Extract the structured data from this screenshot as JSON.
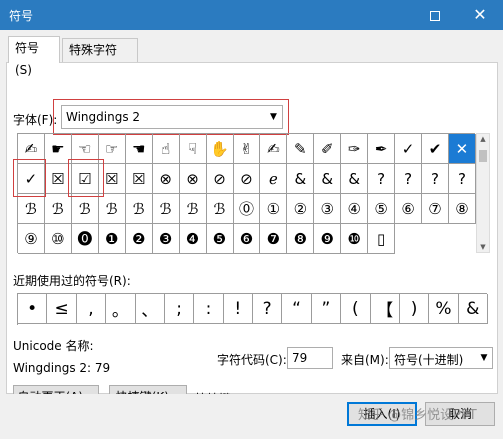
{
  "window": {
    "title": "符号"
  },
  "tabs": [
    {
      "label": "符号(S)"
    },
    {
      "label": "特殊字符(P)"
    }
  ],
  "font": {
    "label": "字体(F):",
    "value": "Wingdings 2",
    "dropdown_icon": "chevron-down-icon"
  },
  "symbols": [
    "✍",
    "☛",
    "☜",
    "☞",
    "☚",
    "☝",
    "☟",
    "✋",
    "✌",
    "✍",
    "✎",
    "✐",
    "✑",
    "✒",
    "✓",
    "✔",
    "✕",
    "✓",
    "☒",
    "☑",
    "☒",
    "☒",
    "⊗",
    "⊗",
    "⊘",
    "⊘",
    "ℯ",
    "&",
    "&",
    "&",
    "?",
    "?",
    "?",
    "?",
    "ℬ",
    "ℬ",
    "ℬ",
    "ℬ",
    "ℬ",
    "ℬ",
    "ℬ",
    "ℬ",
    "⓪",
    "①",
    "②",
    "③",
    "④",
    "⑤",
    "⑥",
    "⑦",
    "⑧",
    "⑨",
    "⑩",
    "⓿",
    "❶",
    "❷",
    "❸",
    "❹",
    "❺",
    "❻",
    "❼",
    "❽",
    "❾",
    "❿",
    "▯"
  ],
  "selected_symbol": "✕",
  "recent": {
    "label": "近期使用过的符号(R):",
    "items": [
      "•",
      "≤",
      ",",
      "。",
      "、",
      ";",
      ":",
      "!",
      "?",
      "“",
      "”",
      "(",
      "【",
      ")",
      "%",
      "&"
    ]
  },
  "unicode": {
    "name_label": "Unicode 名称:",
    "name_value": "Wingdings 2: 79"
  },
  "code": {
    "label": "字符代码(C):",
    "value": "79"
  },
  "from": {
    "label": "来自(M):",
    "value": "符号(十进制)"
  },
  "buttons": {
    "autocorrect": "自动更正(A)...",
    "shortcut": "快捷键(K)...",
    "shortcut_label": "快捷键:",
    "insert": "插入(I)",
    "cancel": "取消"
  },
  "watermark": "知乎 @锦乡悦设PPT",
  "colors": {
    "titlebar": "#2b7bc0",
    "selection": "#1b7bd4",
    "annotation": "#d04040"
  }
}
